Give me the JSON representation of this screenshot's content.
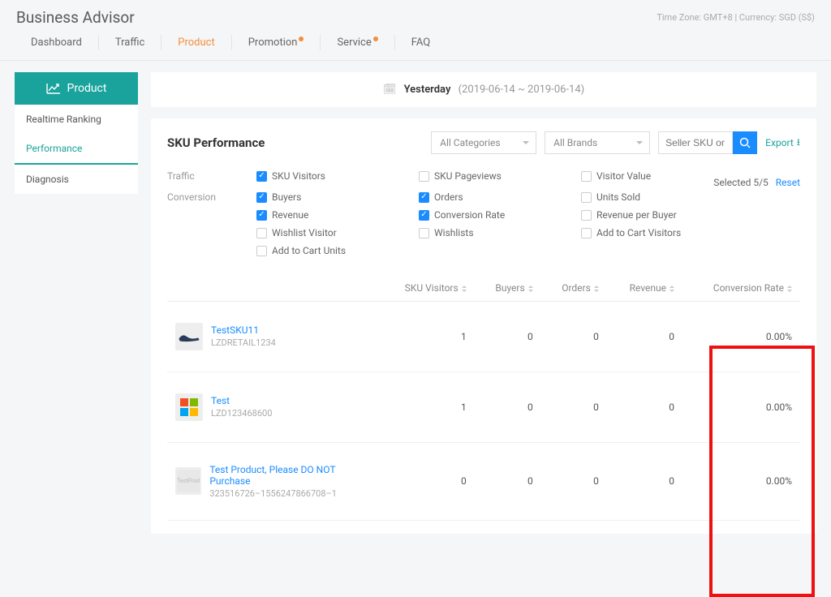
{
  "header": {
    "brand": "Business Advisor",
    "meta": "Time Zone: GMT+8 | Currency: SGD (S$)"
  },
  "mainnav": {
    "items": [
      "Dashboard",
      "Traffic",
      "Product",
      "Promotion",
      "Service",
      "FAQ"
    ],
    "active_index": 2,
    "badge_indices": [
      3,
      4
    ]
  },
  "sidebar": {
    "head": "Product",
    "items": [
      "Realtime Ranking",
      "Performance",
      "Diagnosis"
    ],
    "active_index": 1
  },
  "datebar": {
    "label": "Yesterday",
    "range": "(2019-06-14 ~ 2019-06-14)"
  },
  "panel": {
    "title": "SKU Performance",
    "category_select": "All Categories",
    "brand_select": "All Brands",
    "search_placeholder": "Seller SKU or Name",
    "export": "Export",
    "selected_text": "Selected 5/5",
    "reset": "Reset"
  },
  "metrics": {
    "sections": [
      {
        "label": "Traffic",
        "opts": [
          {
            "label": "SKU Visitors",
            "checked": true
          },
          {
            "label": "SKU Pageviews",
            "checked": false
          },
          {
            "label": "Visitor Value",
            "checked": false
          }
        ]
      },
      {
        "label": "Conversion",
        "opts": [
          {
            "label": "Buyers",
            "checked": true
          },
          {
            "label": "Orders",
            "checked": true
          },
          {
            "label": "Units Sold",
            "checked": false
          },
          {
            "label": "Revenue",
            "checked": true
          },
          {
            "label": "Conversion Rate",
            "checked": true
          },
          {
            "label": "Revenue per Buyer",
            "checked": false
          },
          {
            "label": "Wishlist Visitor",
            "checked": false
          },
          {
            "label": "Wishlists",
            "checked": false
          },
          {
            "label": "Add to Cart Visitors",
            "checked": false
          },
          {
            "label": "Add to Cart Units",
            "checked": false
          }
        ]
      }
    ]
  },
  "table": {
    "columns": [
      "SKU Visitors",
      "Buyers",
      "Orders",
      "Revenue",
      "Conversion Rate"
    ],
    "rows": [
      {
        "name": "TestSKU11",
        "subtitle": "LZDRETAIL1234",
        "thumb": "shoe",
        "sku_visitors": "1",
        "buyers": "0",
        "orders": "0",
        "revenue": "0",
        "conversion_rate": "0.00%"
      },
      {
        "name": "Test",
        "subtitle": "LZD123468600",
        "thumb": "ms",
        "sku_visitors": "1",
        "buyers": "0",
        "orders": "0",
        "revenue": "0",
        "conversion_rate": "0.00%"
      },
      {
        "name": "Test Product, Please DO NOT Purchase",
        "subtitle": "323516726–1556247866708–1",
        "thumb": "plain",
        "sku_visitors": "0",
        "buyers": "0",
        "orders": "0",
        "revenue": "0",
        "conversion_rate": "0.00%"
      }
    ]
  }
}
